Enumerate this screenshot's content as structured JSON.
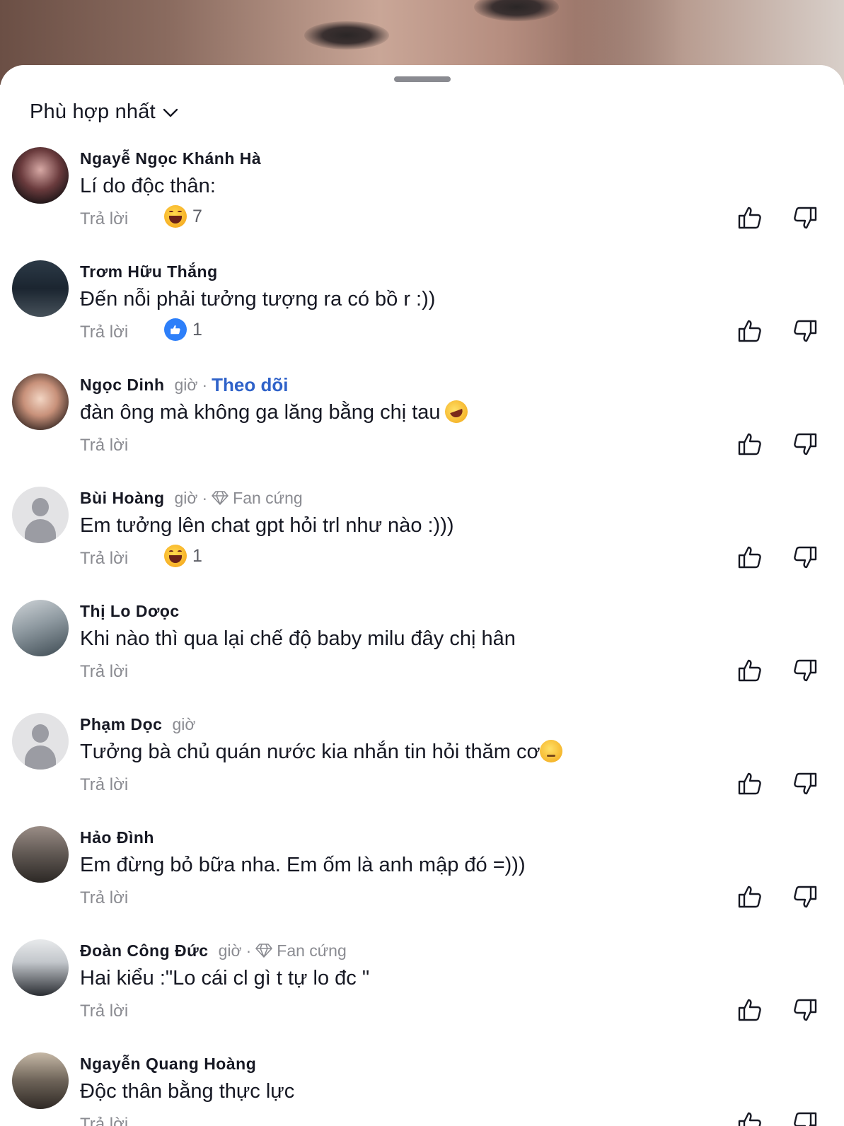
{
  "sort": {
    "label": "Phù hợp nhất"
  },
  "reply_label": "Trả lời",
  "comments": [
    {
      "name": "Ngayễ Ngọc Khánh Hà",
      "meta": "",
      "follow": "",
      "badge": "",
      "text": "Lí do độc thân:",
      "reaction": {
        "type": "haha",
        "count": "7"
      },
      "avatar": "av1"
    },
    {
      "name": "Trơm Hữu Thắng",
      "meta": "",
      "follow": "",
      "badge": "",
      "text": "Đến nỗi phải tưởng tượng ra có bồ r :))",
      "reaction": {
        "type": "like",
        "count": "1"
      },
      "avatar": "av2"
    },
    {
      "name": "Ngọc Dinh",
      "meta": "giờ",
      "follow": "Theo dõi",
      "badge": "",
      "text": "đàn ông mà không ga lăng bằng chị tau",
      "trailing_emoji": "rofl",
      "reaction": null,
      "avatar": "av3"
    },
    {
      "name": "Bùi Hoàng",
      "meta": "giờ",
      "follow": "",
      "badge": "Fan cứng",
      "text": "Em tưởng lên chat gpt hỏi trl như nào :)))",
      "reaction": {
        "type": "haha",
        "count": "1"
      },
      "avatar": "placeholder"
    },
    {
      "name": "Thị Lo Dơọc",
      "meta": "",
      "follow": "",
      "badge": "",
      "text": "Khi nào thì qua lại chế độ baby milu đây chị hân",
      "reaction": null,
      "avatar": "av5"
    },
    {
      "name": "Phạm Dọc",
      "meta": "giờ",
      "follow": "",
      "badge": "",
      "text": "Tưởng bà chủ quán nước kia nhắn tin hỏi thăm cơ",
      "trailing_emoji": "pensive",
      "reaction": null,
      "avatar": "placeholder"
    },
    {
      "name": "Hảo Đình",
      "meta": "",
      "follow": "",
      "badge": "",
      "text": "Em đừng bỏ bữa nha. Em ốm là anh mập đó =)))",
      "reaction": null,
      "avatar": "av7"
    },
    {
      "name": "Đoàn Công Đức",
      "meta": "giờ",
      "follow": "",
      "badge": "Fan cứng",
      "text": "Hai kiểu :\"Lo cái cl gì t tự lo đc \"",
      "reaction": null,
      "avatar": "av8"
    },
    {
      "name": "Ngayễn Quang Hoàng",
      "meta": "",
      "follow": "",
      "badge": "",
      "text": "Độc thân bằng thực lực",
      "reaction": null,
      "avatar": "av9"
    }
  ]
}
